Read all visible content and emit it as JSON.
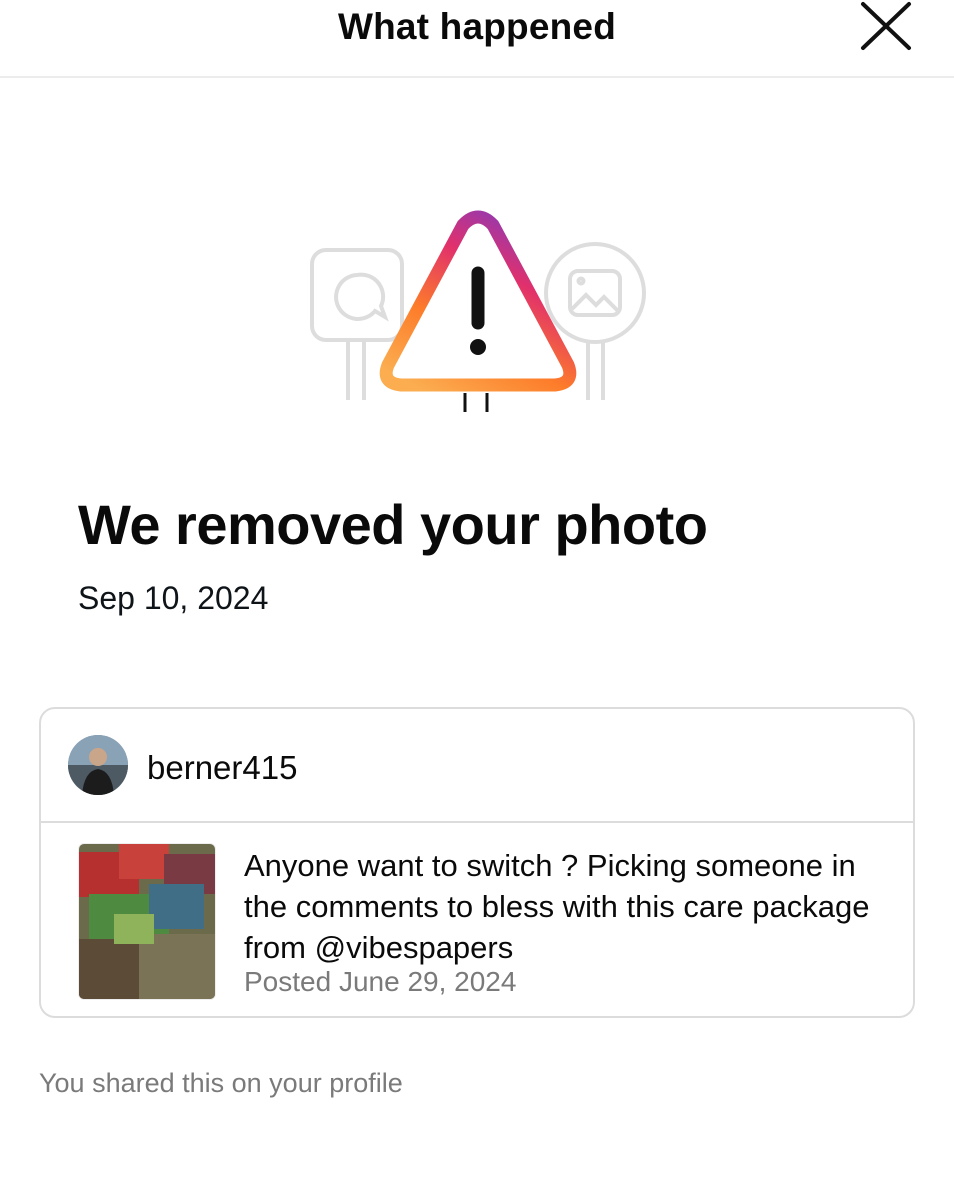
{
  "header": {
    "title": "What happened",
    "close_icon": "close-icon"
  },
  "illustration": {
    "icons": [
      "comment-sign-icon",
      "warning-triangle-icon",
      "image-sign-icon"
    ],
    "gradient_colors": [
      "#8a3ab9",
      "#e1306c",
      "#fd7c2a",
      "#fbad50"
    ]
  },
  "main": {
    "title": "We removed your photo",
    "date": "Sep 10, 2024"
  },
  "post_card": {
    "username": "berner415",
    "caption": "Anyone want to switch ? Picking someone in the comments to bless with this care package from @vibespapers",
    "posted": "Posted June 29, 2024"
  },
  "footer": {
    "note": "You shared this on your profile"
  }
}
